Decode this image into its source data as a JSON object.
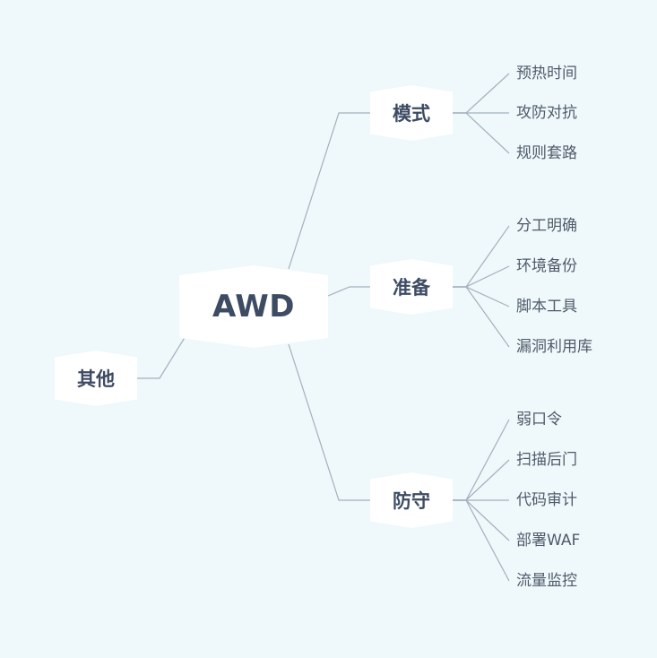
{
  "mindmap": {
    "root": {
      "label": "AWD"
    },
    "other": {
      "label": "其他"
    },
    "branches": [
      {
        "label": "模式",
        "children": [
          "预热时间",
          "攻防对抗",
          "规则套路"
        ]
      },
      {
        "label": "准备",
        "children": [
          "分工明确",
          "环境备份",
          "脚本工具",
          "漏洞利用库"
        ]
      },
      {
        "label": "防守",
        "children": [
          "弱口令",
          "扫描后门",
          "代码审计",
          "部署WAF",
          "流量监控"
        ]
      }
    ]
  },
  "colors": {
    "background": "#eff8fb",
    "node_fill": "#ffffff",
    "node_text": "#3d4b63",
    "leaf_text": "#4f5b6a",
    "connector": "#a3b1bd"
  }
}
